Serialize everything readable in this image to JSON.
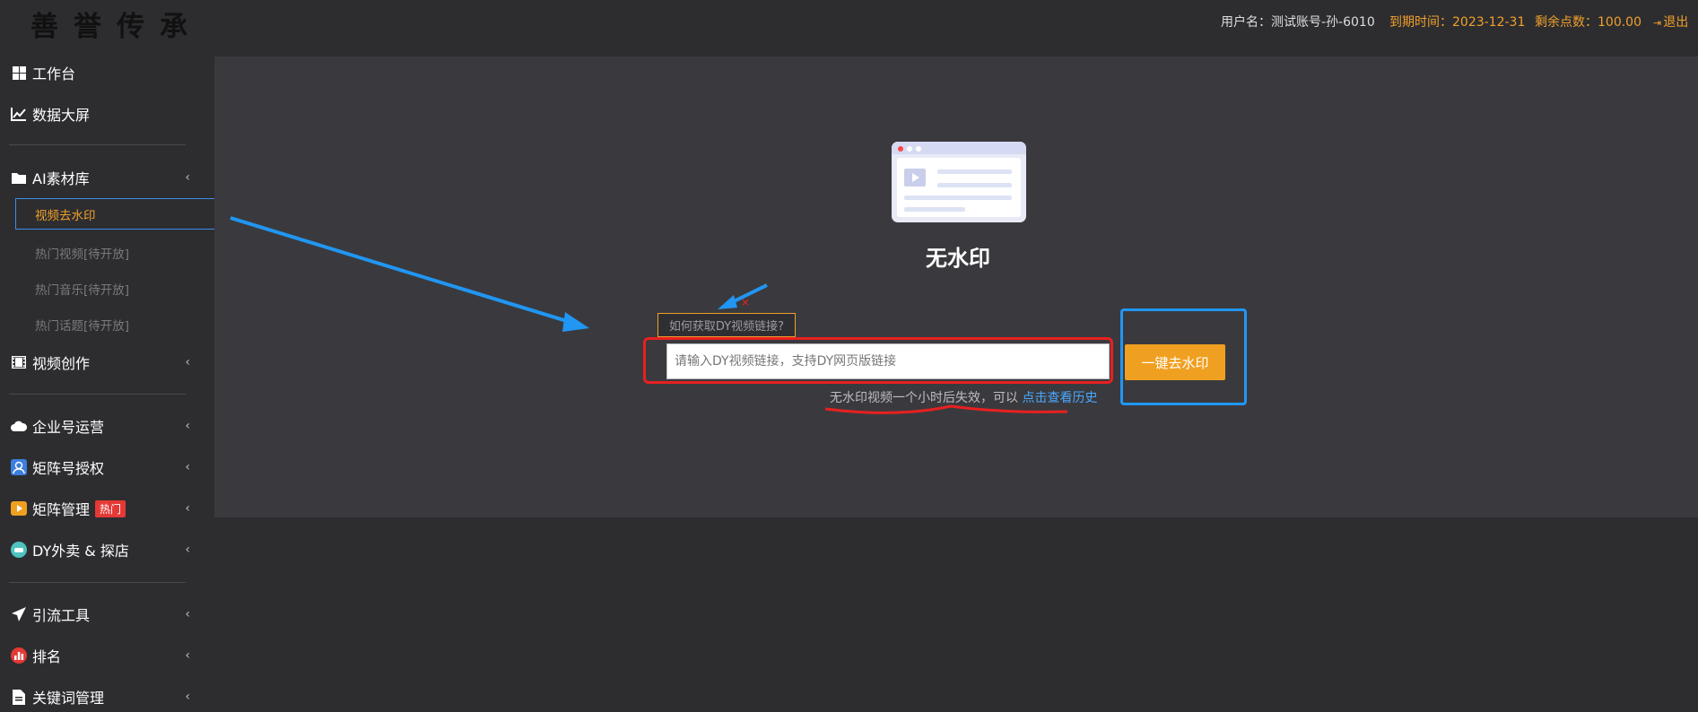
{
  "header": {
    "logo_text": "善誉传承",
    "username_text": "用户名：测试账号-孙-6010",
    "expire_text": "到期时间：2023-12-31",
    "points_text": "剩余点数：100.00",
    "logout_label": "退出"
  },
  "sidebar": {
    "workbench": "工作台",
    "dashboard": "数据大屏",
    "ai_library": "AI素材库",
    "ai_sub": {
      "watermark": "视频去水印",
      "hot_video": "热门视频[待开放]",
      "hot_music": "热门音乐[待开放]",
      "hot_topic": "热门话题[待开放]"
    },
    "video_create": "视频创作",
    "enterprise_ops": "企业号运营",
    "matrix_auth": "矩阵号授权",
    "matrix_manage": "矩阵管理",
    "hot_badge": "热门",
    "dy_takeaway": "DY外卖 & 探店",
    "traffic_tools": "引流工具",
    "ranking": "排名",
    "keyword_manage": "关键词管理"
  },
  "main": {
    "title": "无水印",
    "help_link": "如何获取DY视频链接?",
    "input_placeholder": "请输入DY视频链接，支持DY网页版链接",
    "button_label": "一键去水印",
    "note_text": "无水印视频一个小时后失效，可以 ",
    "history_link": "点击查看历史"
  },
  "colors": {
    "accent": "#f0a020",
    "link": "#4aa8ff",
    "annotation_red": "#e82020",
    "annotation_blue": "#2196f3"
  }
}
